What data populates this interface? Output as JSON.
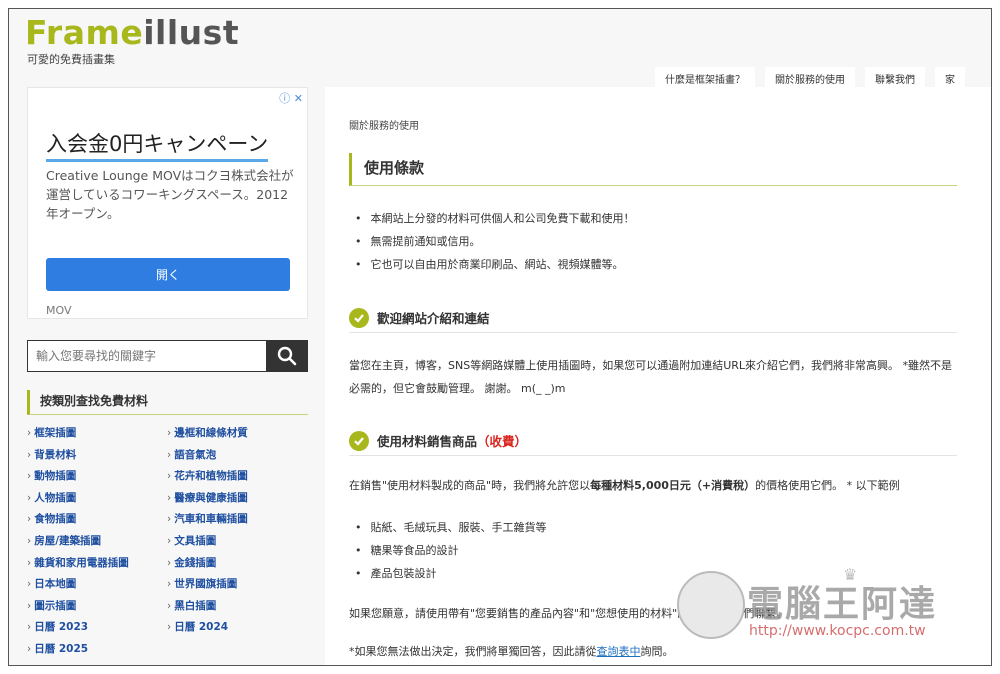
{
  "header": {
    "logo_part1": "Frame",
    "logo_part2": "illust",
    "tagline": "可愛的免費插畫集",
    "nav": [
      "什麼是框架插畫？",
      "關於服務的使用",
      "聯繫我們",
      "家"
    ]
  },
  "ad": {
    "title": "入会金0円キャンペーン",
    "body": "Creative Lounge MOVはコクヨ株式会社が運営しているコワーキングスペース。2012年オープン。",
    "brand": "MOV",
    "button": "開く",
    "info_icon": "info-icon",
    "close_icon": "close-icon"
  },
  "search": {
    "placeholder": "輸入您要尋找的關鍵字",
    "icon": "search-icon"
  },
  "categories": {
    "heading": "按類別查找免費材料",
    "items": [
      "框架插圖",
      "邊框和線條材質",
      "背景材料",
      "語音氣泡",
      "動物插圖",
      "花卉和植物插圖",
      "人物插圖",
      "醫療與健康插圖",
      "食物插圖",
      "汽車和車輛插圖",
      "房屋/建築插圖",
      "文具插圖",
      "雜貨和家用電器插圖",
      "金錢插圖",
      "日本地圖",
      "世界國旗插圖",
      "圖示插圖",
      "黑白插圖",
      "日曆 2023",
      "日曆 2024",
      "日曆 2025"
    ]
  },
  "main": {
    "breadcrumb": "關於服務的使用",
    "terms_title": "使用條款",
    "terms": [
      "本網站上分發的材料可供個人和公司免費下載和使用！",
      "無需提前通知或信用。",
      "它也可以自由用於商業印刷品、網站、視頻媒體等。"
    ],
    "link_title": "歡迎網站介紹和連結",
    "link_text": "當您在主頁，博客，SNS等網路媒體上使用插圖時，如果您可以通過附加連結URL來介紹它們，我們將非常高興。 *雖然不是必需的，但它會鼓勵管理。 謝謝。 m(_ _)m",
    "sell_title": "使用材料銷售商品",
    "sell_title_paid": "（收費）",
    "sell_text_a": "在銷售\"使用材料製成的商品\"時，我們將允許您以",
    "sell_text_bold": "每種材料5,000日元（+消費稅）",
    "sell_text_b": "的價格使用它們。 * 以下範例",
    "uses": [
      "貼紙、毛絨玩具、服裝、手工雜貨等",
      "糖果等食品的設計",
      "產品包裝設計"
    ],
    "contact_a": "如果您願意，請使用帶有\"您要銷售的產品內容\"和\"您想使用的材料\"的",
    "contact_link": "查詢表",
    "contact_b": "與我們聯繫。",
    "note_a": "*如果您無法做出決定，我們將單獨回答，因此請從",
    "note_link": "查詢表中",
    "note_b": "詢問。"
  },
  "watermark": {
    "text": "電腦王阿達",
    "url": "http://www.kocpc.com.tw"
  },
  "colors": {
    "accent": "#a8b81c",
    "link": "#1f4fa0",
    "ad_button": "#2f7de1",
    "paid": "#d9251d"
  }
}
